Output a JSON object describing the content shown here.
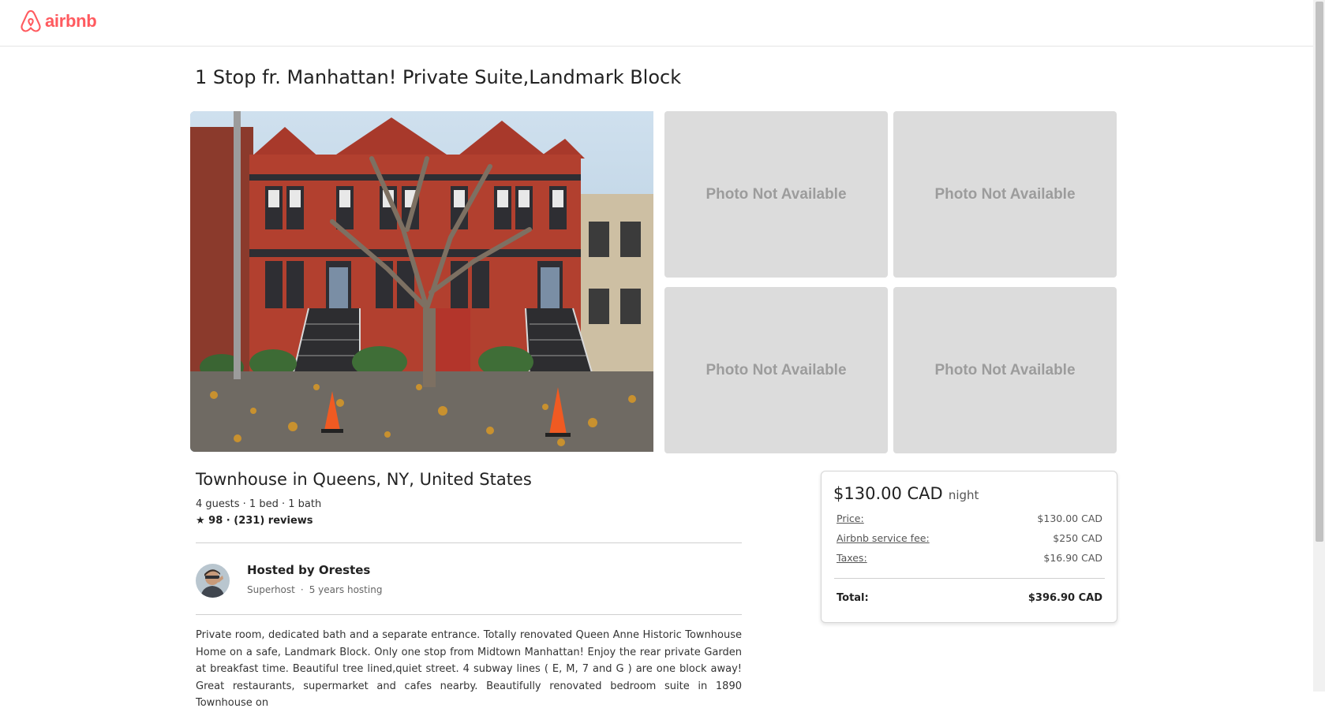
{
  "brand": {
    "name": "airbnb",
    "color": "#ff5a5f",
    "icon": "airbnb-belo-icon"
  },
  "listing": {
    "title": "1 Stop fr. Manhattan! Private Suite,Landmark Block",
    "subtitle": "Townhouse in Queens, NY, United States",
    "meta": "4 guests · 1 bed · 1 bath",
    "rating": "★ 98 · (231) reviews",
    "description": "Private room, dedicated bath and a separate entrance. Totally renovated Queen Anne Historic Townhouse Home on a safe, Landmark Block. Only one stop from Midtown Manhattan! Enjoy the rear private Garden at breakfast time. Beautiful tree lined,quiet street. 4 subway lines ( E, M, 7 and G ) are one block away! Great restaurants, supermarket and cafes nearby. Beautifully renovated bedroom suite in 1890 Townhouse on"
  },
  "photos": {
    "main_alt": "Red Queen Anne townhouses with autumn leaves",
    "placeholders": [
      "Photo Not Available",
      "Photo Not Available",
      "Photo Not Available",
      "Photo Not Available"
    ]
  },
  "host": {
    "name": "Hosted by Orestes",
    "status": "Superhost",
    "separator": "·",
    "experience": "5 years hosting"
  },
  "pricing": {
    "amount": "$130.00 CAD",
    "unit": "night",
    "rows": [
      {
        "label": "Price:",
        "value": "$130.00 CAD"
      },
      {
        "label": "Airbnb service fee:",
        "value": "$250 CAD"
      },
      {
        "label": "Taxes:",
        "value": "$16.90 CAD"
      }
    ],
    "total_label": "Total:",
    "total_value": "$396.90 CAD"
  }
}
